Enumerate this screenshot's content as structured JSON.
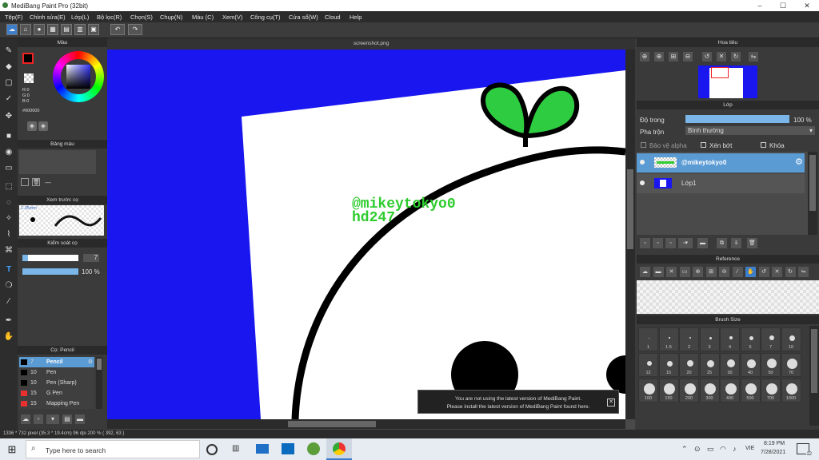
{
  "app": {
    "title": "MediBang Paint Pro (32bit)",
    "minimize": "–",
    "maximize": "☐",
    "close": "✕"
  },
  "menu": [
    "Tệp(F)",
    "Chỉnh sửa(E)",
    "Lớp(L)",
    "Bộ lọc(R)",
    "Chọn(S)",
    "Chụp(N)",
    "Màu (C)",
    "Xem(V)",
    "Công cụ(T)",
    "Cửa sổ(W)",
    "Cloud",
    "Help"
  ],
  "color_panel": {
    "title": "Màu",
    "r": "R:0",
    "g": "G:0",
    "b": "B:0",
    "hex": "#000000"
  },
  "palette_panel": {
    "title": "Bảng màu",
    "value": "---"
  },
  "brush_preview": {
    "title": "Xem trước cọ",
    "size": "1.35mm"
  },
  "brush_control": {
    "title": "Kiểm soát cọ",
    "size_value": "7",
    "opacity_value": "100 %",
    "opacity": 1.0,
    "size": 0.1
  },
  "brushes": {
    "title": "Cọ: Pencil",
    "items": [
      {
        "size": "7",
        "name": "Pencil",
        "color": "#000000",
        "selected": true
      },
      {
        "size": "10",
        "name": "Pen",
        "color": "#000000",
        "selected": false
      },
      {
        "size": "10",
        "name": "Pen (Sharp)",
        "color": "#000000",
        "selected": false
      },
      {
        "size": "15",
        "name": "G Pen",
        "color": "#e83030",
        "selected": false
      },
      {
        "size": "15",
        "name": "Mapping Pen",
        "color": "#e83030",
        "selected": false
      }
    ]
  },
  "canvas": {
    "tab": "screenshot.png",
    "text_line1": "@mikeytokyo0",
    "text_line2": "hd247",
    "bg_color": "#1a16f0",
    "text_color": "#2ecc2e",
    "leaf_color": "#2ecc40"
  },
  "notification": {
    "line1": "You are not using the latest version of MediBang Paint.",
    "line2": "Please install the latest version of MediBang Paint found here."
  },
  "navigator": {
    "title": "Hoa tiêu"
  },
  "layers": {
    "title": "Lớp",
    "opacity_label": "Độ trong",
    "opacity_value": "100 %",
    "blend_label": "Pha trộn",
    "blend_value": "Bình thường",
    "protect_alpha": "Bảo vệ alpha",
    "clipping": "Xén bớt",
    "lock": "Khóa",
    "items": [
      {
        "name": "@mikeytokyo0",
        "selected": true
      },
      {
        "name": "Lớp1",
        "selected": false
      }
    ]
  },
  "reference": {
    "title": "Reference"
  },
  "brush_size": {
    "title": "Brush Size",
    "labels": [
      "1",
      "1.5",
      "2",
      "3",
      "4",
      "5",
      "7",
      "10",
      "12",
      "15",
      "20",
      "25",
      "30",
      "40",
      "50",
      "70",
      "100",
      "150",
      "200",
      "300",
      "400",
      "500",
      "700",
      "1000"
    ]
  },
  "status": {
    "text": "1336 * 732 pixel  (35.3 * 19.4cm)  96 dpi  200 %  ( 392, 63 )"
  },
  "taskbar": {
    "search": "Type here to search",
    "time": "8:19 PM",
    "date": "7/28/2021",
    "lang": "VIE",
    "notif": "12"
  }
}
